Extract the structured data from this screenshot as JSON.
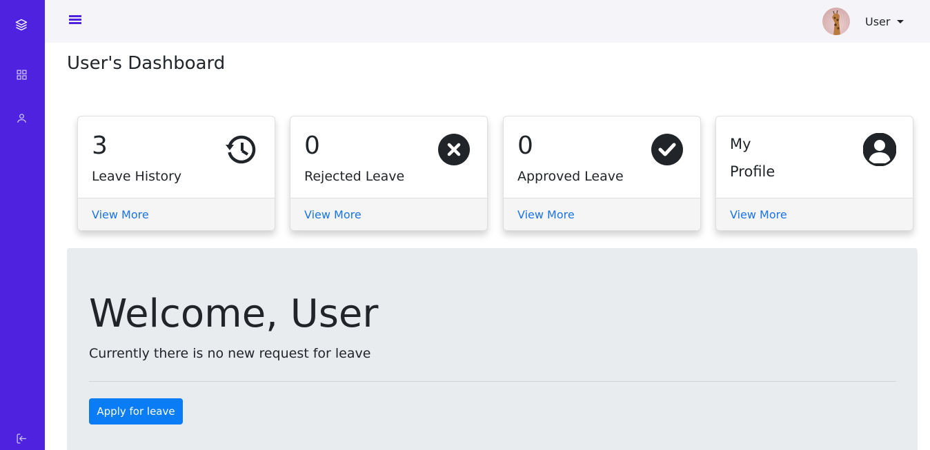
{
  "sidebar": {
    "items": [
      {
        "icon": "layers-icon"
      },
      {
        "icon": "grid-icon"
      },
      {
        "icon": "user-icon"
      }
    ],
    "logout_icon": "logout-icon",
    "background": "#4e22de"
  },
  "topbar": {
    "menu_icon": "hamburger-icon",
    "user_name": "User"
  },
  "page": {
    "title": "User's Dashboard"
  },
  "cards": [
    {
      "count": "3",
      "label": "Leave History",
      "icon": "history-icon",
      "link": "View More"
    },
    {
      "count": "0",
      "label": "Rejected Leave",
      "icon": "close-circle-icon",
      "link": "View More"
    },
    {
      "count": "0",
      "label": "Approved Leave",
      "icon": "check-circle-icon",
      "link": "View More"
    },
    {
      "line1": "My",
      "line2": "Profile",
      "icon": "user-circle-icon",
      "link": "View More"
    }
  ],
  "welcome": {
    "heading": "Welcome, User",
    "message": "Currently there is no new request for leave",
    "button": "Apply for leave"
  },
  "colors": {
    "accent": "#4e22de",
    "link": "#1a73e8",
    "primary_button": "#0a7cf5"
  }
}
